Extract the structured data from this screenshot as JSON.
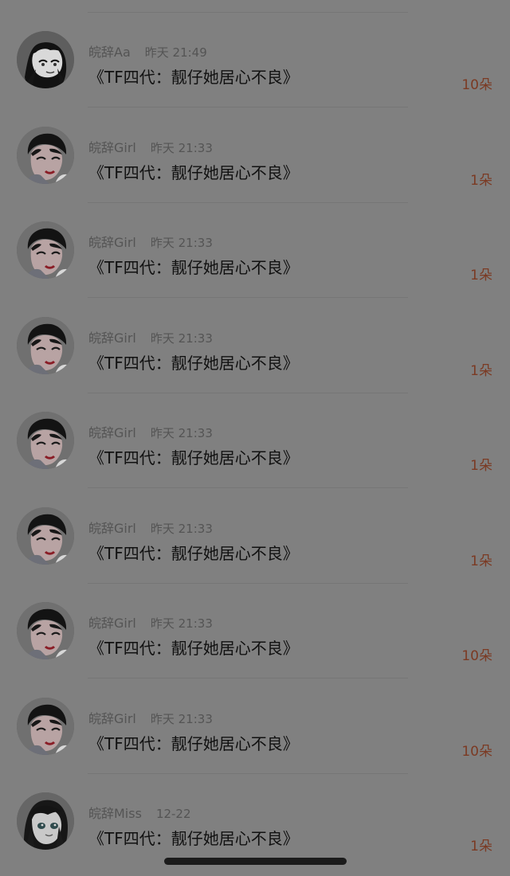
{
  "list": {
    "items": [
      {
        "username": "皖辞Aa",
        "time": "昨天 21:49",
        "title": "《TF四代：靓仔她居心不良》",
        "count": "10朵",
        "avatar_icon": "anime-portrait-avatar-icon"
      },
      {
        "username": "皖辞Girl",
        "time": "昨天 21:33",
        "title": "《TF四代：靓仔她居心不良》",
        "count": "1朵",
        "avatar_icon": "person-portrait-avatar-icon"
      },
      {
        "username": "皖辞Girl",
        "time": "昨天 21:33",
        "title": "《TF四代：靓仔她居心不良》",
        "count": "1朵",
        "avatar_icon": "person-portrait-avatar-icon"
      },
      {
        "username": "皖辞Girl",
        "time": "昨天 21:33",
        "title": "《TF四代：靓仔她居心不良》",
        "count": "1朵",
        "avatar_icon": "person-portrait-avatar-icon"
      },
      {
        "username": "皖辞Girl",
        "time": "昨天 21:33",
        "title": "《TF四代：靓仔她居心不良》",
        "count": "1朵",
        "avatar_icon": "person-portrait-avatar-icon"
      },
      {
        "username": "皖辞Girl",
        "time": "昨天 21:33",
        "title": "《TF四代：靓仔她居心不良》",
        "count": "1朵",
        "avatar_icon": "person-portrait-avatar-icon"
      },
      {
        "username": "皖辞Girl",
        "time": "昨天 21:33",
        "title": "《TF四代：靓仔她居心不良》",
        "count": "10朵",
        "avatar_icon": "person-portrait-avatar-icon"
      },
      {
        "username": "皖辞Girl",
        "time": "昨天 21:33",
        "title": "《TF四代：靓仔她居心不良》",
        "count": "10朵",
        "avatar_icon": "person-portrait-avatar-icon"
      },
      {
        "username": "皖辞Miss",
        "time": "12-22",
        "title": "《TF四代：靓仔她居心不良》",
        "count": "1朵",
        "avatar_icon": "anime-portrait-avatar-icon"
      }
    ]
  },
  "colors": {
    "overlay_gray": "#808080",
    "accent_count": "#7b3a23",
    "text_primary": "#111111",
    "text_secondary": "#545454",
    "home_indicator": "#1b1b1b"
  },
  "home_indicator_icon": "home-indicator-icon"
}
